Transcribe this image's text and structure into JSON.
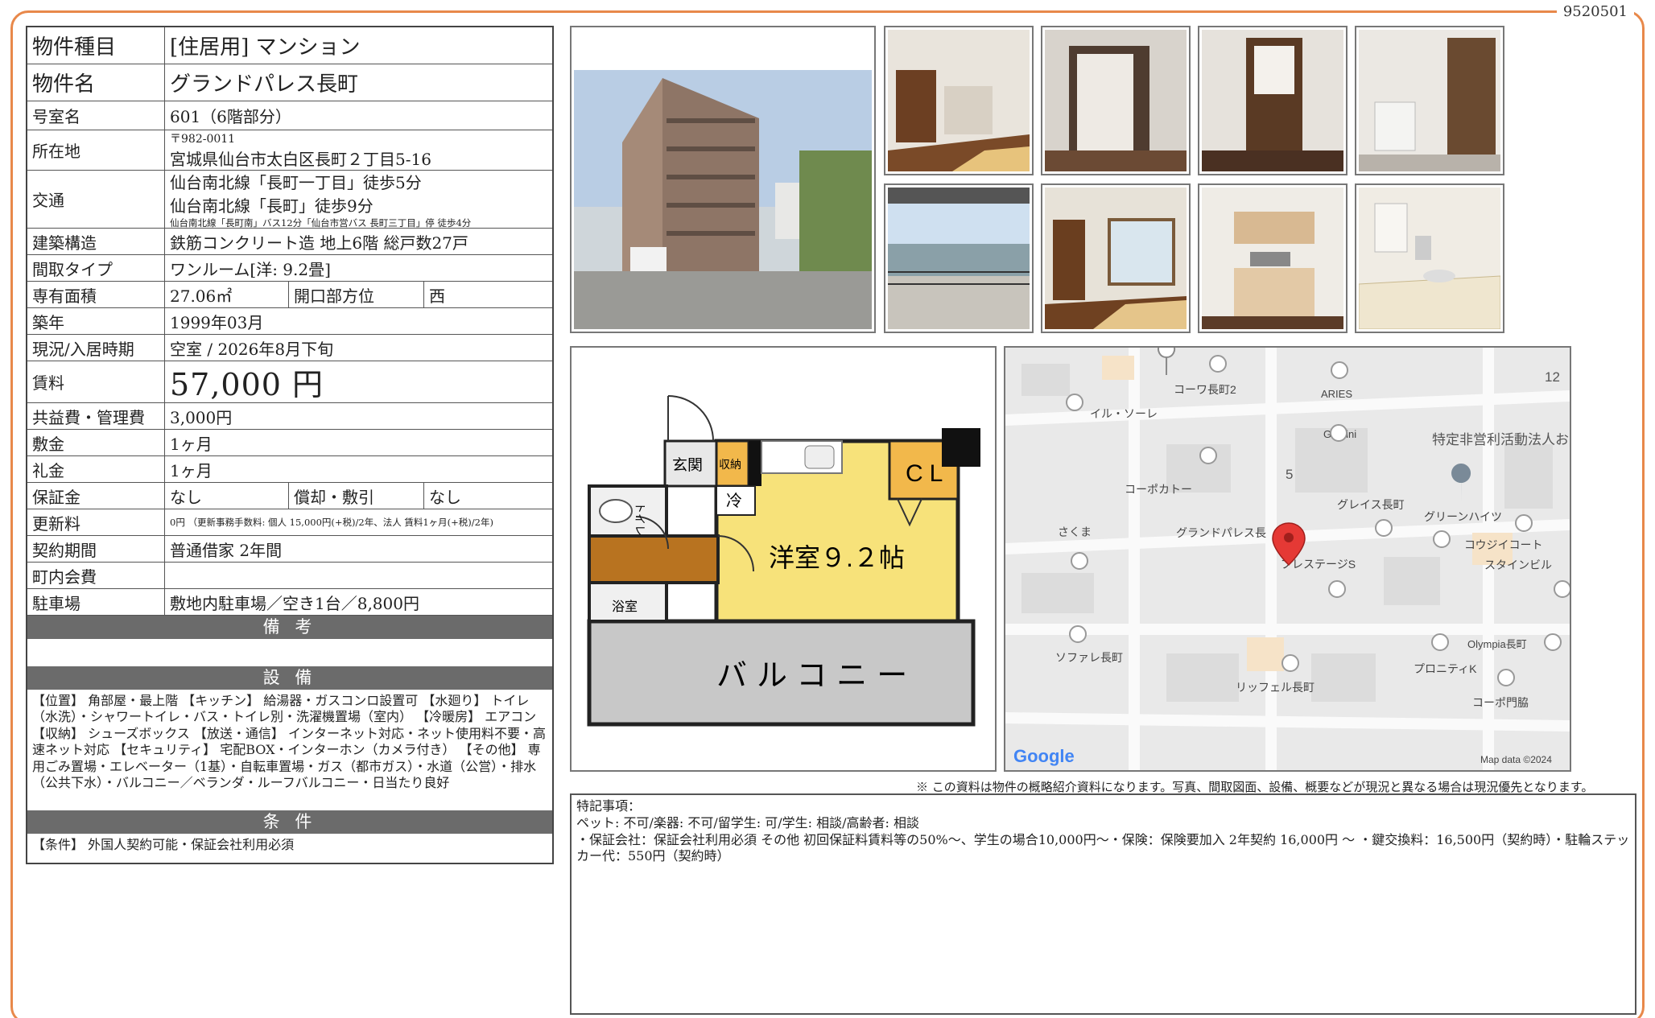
{
  "doc_id": "9520501",
  "spec": {
    "type_label": "物件種目",
    "type_value": "[住居用] マンション",
    "name_label": "物件名",
    "name_value": "グランドパレス長町",
    "room_label": "号室名",
    "room_value": "601（6階部分）",
    "address_label": "所在地",
    "address_zip": "〒982-0011",
    "address_value": "宮城県仙台市太白区長町２丁目5-16",
    "transit_label": "交通",
    "transit_1": "仙台南北線「長町一丁目」徒歩5分",
    "transit_2": "仙台南北線「長町」徒歩9分",
    "transit_3": "仙台南北線「長町南」バス12分「仙台市営バス 長町三丁目」停 徒歩4分",
    "structure_label": "建築構造",
    "structure_value": "鉄筋コンクリート造 地上6階 総戸数27戸",
    "layout_label": "間取タイプ",
    "layout_value": "ワンルーム[洋: 9.2畳]",
    "area_label": "専有面積",
    "area_value": "27.06㎡",
    "direction_label": "開口部方位",
    "direction_value": "西",
    "built_label": "築年",
    "built_value": "1999年03月",
    "status_label": "現況/入居時期",
    "status_value": "空室 / 2026年8月下旬",
    "rent_label": "賃料",
    "rent_value": "57,000 円",
    "fee_label": "共益費・管理費",
    "fee_value": "3,000円",
    "deposit_label": "敷金",
    "deposit_value": "1ヶ月",
    "keymoney_label": "礼金",
    "keymoney_value": "1ヶ月",
    "guarantee_label": "保証金",
    "guarantee_value": "なし",
    "amort_label": "償却・敷引",
    "amort_value": "なし",
    "renewal_label": "更新料",
    "renewal_value": "0円 （更新事務手数料: 個人 15,000円(+税)/2年、法人 賃料1ヶ月(+税)/2年)",
    "contract_label": "契約期間",
    "contract_value": "普通借家 2年間",
    "assoc_label": "町内会費",
    "assoc_value": "",
    "parking_label": "駐車場",
    "parking_value": "敷地内駐車場／空き1台／8,800円"
  },
  "sections": {
    "remarks_head": "備 考",
    "remarks_body": "",
    "equipment_head": "設 備",
    "equipment_body": "【位置】 角部屋・最上階 【キッチン】 給湯器・ガスコンロ設置可 【水廻り】 トイレ（水洗）・シャワートイレ・バス・トイレ別・洗濯機置場（室内） 【冷暖房】 エアコン 【収納】 シューズボックス 【放送・通信】 インターネット対応・ネット使用料不要・高速ネット対応 【セキュリティ】 宅配BOX・インターホン（カメラ付き） 【その他】 専用ごみ置場・エレベーター（1基）・自転車置場・ガス（都市ガス）・水道（公営）・排水（公共下水）・バルコニー／ベランダ・ルーフバルコニー・日当たり良好",
    "conditions_head": "条 件",
    "conditions_body": "【条件】 外国人契約可能・保証会社利用必須"
  },
  "floorplan": {
    "genkan": "玄関",
    "storage": "収納",
    "toilet": "トイレ",
    "fridge": "冷",
    "closet": "CL",
    "bath": "浴室",
    "room": "洋室９.２帖",
    "balcony": "バルコニー"
  },
  "map": {
    "places": [
      "コーワ長町2",
      "ARIES",
      "イル・ソーレ",
      "Gemini",
      "特定非営利活動法人おりざの家",
      "コーポカトー",
      "グレイス長町",
      "グリーンハイツ",
      "さくま",
      "グランドパレス長",
      "プレステージS",
      "コウジイコート",
      "スタインビル",
      "ソファレ長町",
      "Olympia長町",
      "プロニティK",
      "リッフェル長町",
      "コーポ門脇"
    ],
    "block_5": "5",
    "block_12": "12",
    "google": "Google",
    "credit": "Map data ©2024"
  },
  "footnote": "※ この資料は物件の概略紹介資料になります。写真、間取図面、設備、概要などが現況と異なる場合は現況優先となります。",
  "special": {
    "title": "特記事項：",
    "line1": "ペット: 不可/楽器: 不可/留学生: 可/学生: 相談/高齢者: 相談",
    "line2": "・保証会社：保証会社利用必須 その他 初回保証料賃料等の50%〜、学生の場合10,000円〜・保険：保険要加入 2年契約 16,000円 〜 ・鍵交換料：16,500円（契約時）・駐輪ステッカー代：550円（契約時）"
  },
  "colors": {
    "accent": "#e8884a",
    "section_head": "#6b6b6b",
    "room_yellow": "#f7e27a",
    "closet_orange": "#f2b84b",
    "wood_brown": "#b87320"
  }
}
